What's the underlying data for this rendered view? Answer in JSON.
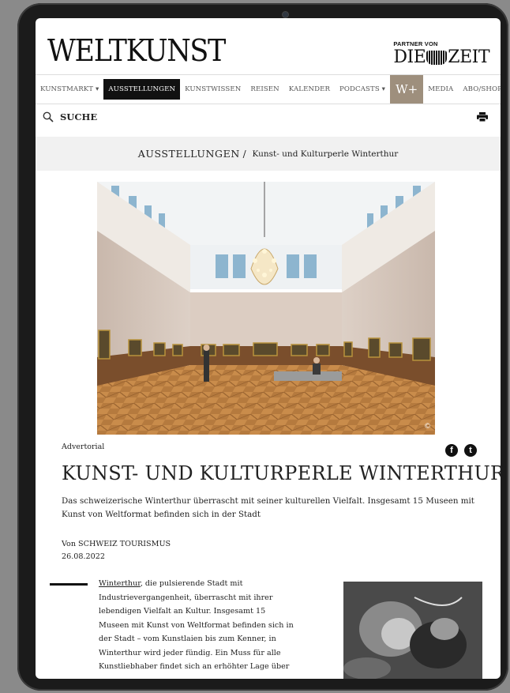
{
  "header": {
    "logo": "WELTKUNST",
    "partner_label": "PARTNER VON",
    "partner_left": "DIE",
    "partner_right": "ZEIT"
  },
  "nav": {
    "items": [
      {
        "label": "KUNSTMARKT ▾"
      },
      {
        "label": "AUSSTELLUNGEN"
      },
      {
        "label": "KUNSTWISSEN"
      },
      {
        "label": "REISEN"
      },
      {
        "label": "KALENDER"
      },
      {
        "label": "PODCASTS ▾"
      },
      {
        "label": "W+"
      },
      {
        "label": "MEDIA"
      },
      {
        "label": "ABO/SHOP ▾"
      }
    ]
  },
  "search": {
    "label": "SUCHE",
    "icon": "search-icon"
  },
  "print": {
    "icon": "printer-icon"
  },
  "breadcrumb": {
    "category": "AUSSTELLUNGEN",
    "separator": " / ",
    "current": "Kunst- und Kulturperle Winterthur"
  },
  "article": {
    "tag": "Advertorial",
    "headline": "KUNST- UND KULTURPERLE WINTERTHUR",
    "lead": "Das schweizerische Winterthur überrascht mit seiner kulturellen Vielfalt. Insgesamt 15 Museen mit Kunst von Weltformat befinden sich in der Stadt",
    "author": "Von SCHWEIZ TOURISMUS",
    "date": "26.08.2022",
    "body_link": "Winterthur",
    "body_text": ", die pulsierende Stadt mit Industrievergangenheit, überrascht mit ihrer lebendigen Vielfalt an Kultur. Insgesamt 15 Museen mit Kunst von Weltformat befinden sich in der Stadt – vom Kunstlaien bis zum Kenner, in Winterthur wird jeder fündig. Ein Muss für alle Kunstliebhaber findet sich an erhöhter Lage über"
  },
  "social": {
    "facebook": "f",
    "twitter": "t"
  },
  "hero_credit": "©",
  "colors": {
    "wplus": "#9e8f7d",
    "active_nav": "#111111",
    "breadcrumb_bg": "#f1f1f1"
  }
}
